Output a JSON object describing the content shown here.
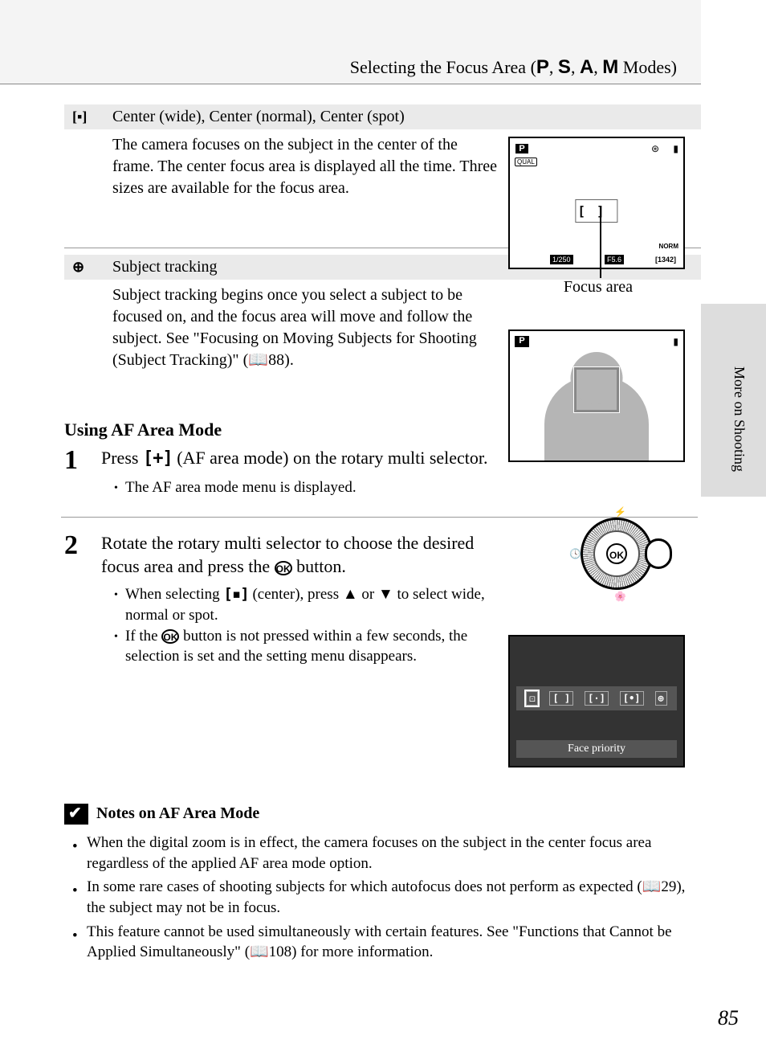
{
  "header": {
    "title_prefix": "Selecting the Focus Area (",
    "modes": [
      "P",
      "S",
      "A",
      "M"
    ],
    "title_suffix": " Modes)"
  },
  "section1": {
    "label": "Center (wide), Center (normal), Center (spot)",
    "body": "The camera focuses on the subject in the center of the frame. The center focus area is displayed all the time. Three sizes are available for the focus area.",
    "focus_caption": "Focus area"
  },
  "screen1": {
    "mode": "P",
    "qual": "QUAL",
    "norm": "NORM",
    "shutter": "1/250",
    "aperture": "F5.6",
    "frames": "[1342]"
  },
  "section2": {
    "label": "Subject tracking",
    "body": "Subject tracking begins once you select a subject to be focused on, and the focus area will move and follow the subject. See \"Focusing on Moving Subjects for Shooting (Subject Tracking)\" (📖88)."
  },
  "screen2": {
    "mode": "P"
  },
  "side_tab": "More on Shooting",
  "using_title": "Using AF Area Mode",
  "step1": {
    "num": "1",
    "main_a": "Press ",
    "main_b": " (AF area mode) on the rotary multi selector.",
    "bullet": "The AF area mode menu is displayed.",
    "rotary_ok": "OK"
  },
  "step2": {
    "num": "2",
    "main_a": "Rotate the rotary multi selector to choose the desired focus area and press the ",
    "main_b": " button.",
    "bullet1_a": "When selecting ",
    "bullet1_b": " (center), press ▲ or ▼ to select wide, normal or spot.",
    "bullet2_a": "If the ",
    "bullet2_b": " button is not pressed within a few seconds, the selection is set and the setting menu disappears."
  },
  "screen3": {
    "options": [
      "⚀",
      "[ ]",
      "[·]",
      "[•]",
      "⊕"
    ],
    "label": "Face priority"
  },
  "notes": {
    "title": "Notes on AF Area Mode",
    "items": [
      "When the digital zoom is in effect, the camera focuses on the subject in the center focus area regardless of the applied AF area mode option.",
      "In some rare cases of shooting subjects for which autofocus does not perform as expected (📖29), the subject may not be in focus.",
      "This feature cannot be used simultaneously with certain features. See \"Functions that Cannot be Applied Simultaneously\" (📖108) for more information."
    ]
  },
  "page_number": "85"
}
